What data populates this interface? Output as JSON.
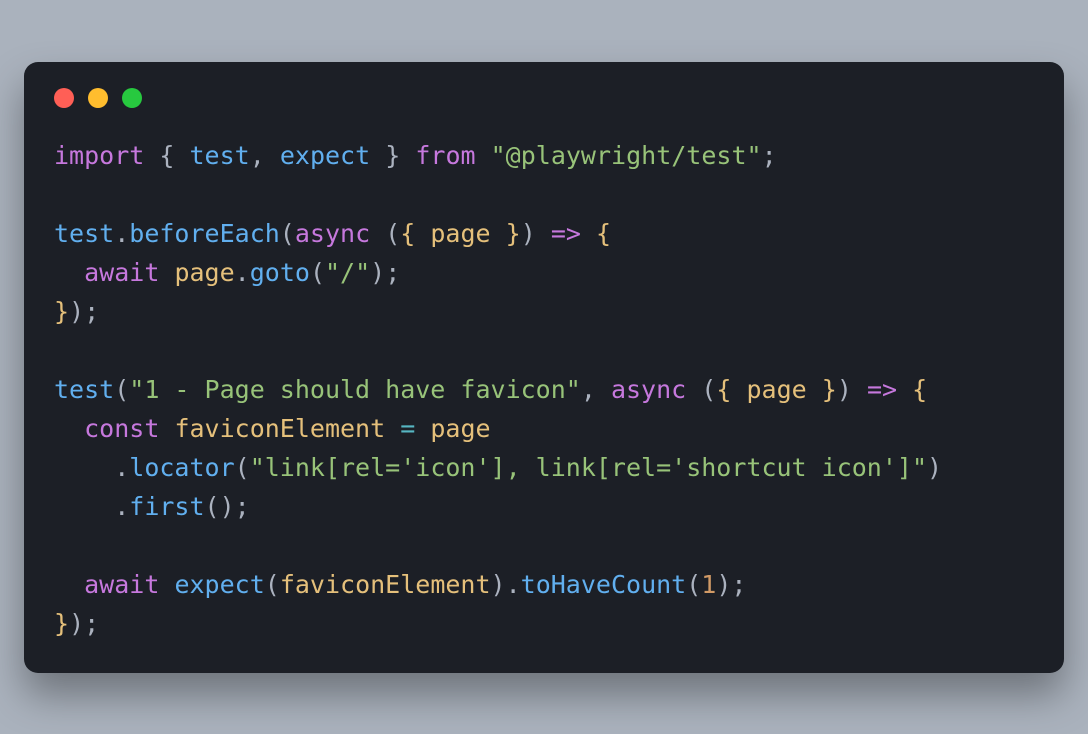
{
  "code": {
    "line1": {
      "kw_import": "import",
      "brace_open": "{",
      "id_test": "test",
      "comma1": ",",
      "id_expect": "expect",
      "brace_close": "}",
      "kw_from": "from",
      "str_module": "\"@playwright/test\"",
      "semi": ";"
    },
    "line3": {
      "fn_test": "test",
      "dot": ".",
      "fn_beforeEach": "beforeEach",
      "paren_open": "(",
      "kw_async": "async",
      "paren2_open": "(",
      "brace_open": "{",
      "id_page": "page",
      "brace_close": "}",
      "paren2_close": ")",
      "arrow": "=>",
      "brace2_open": "{"
    },
    "line4": {
      "kw_await": "await",
      "id_page": "page",
      "dot": ".",
      "fn_goto": "goto",
      "paren_open": "(",
      "str_path": "\"/\"",
      "paren_close": ")",
      "semi": ";"
    },
    "line5": {
      "brace_close": "}",
      "paren_close": ")",
      "semi": ";"
    },
    "line7": {
      "fn_test": "test",
      "paren_open": "(",
      "str_desc": "\"1 - Page should have favicon\"",
      "comma": ",",
      "kw_async": "async",
      "paren2_open": "(",
      "brace_open": "{",
      "id_page": "page",
      "brace_close": "}",
      "paren2_close": ")",
      "arrow": "=>",
      "brace2_open": "{"
    },
    "line8": {
      "kw_const": "const",
      "id_faviconElement": "faviconElement",
      "op_eq": "=",
      "id_page": "page"
    },
    "line9": {
      "dot": ".",
      "fn_locator": "locator",
      "paren_open": "(",
      "str_sel": "\"link[rel='icon'], link[rel='shortcut icon']\"",
      "paren_close": ")"
    },
    "line10": {
      "dot": ".",
      "fn_first": "first",
      "paren_open": "(",
      "paren_close": ")",
      "semi": ";"
    },
    "line12": {
      "kw_await": "await",
      "fn_expect": "expect",
      "paren_open": "(",
      "id_faviconElement": "faviconElement",
      "paren_close": ")",
      "dot": ".",
      "fn_toHaveCount": "toHaveCount",
      "paren2_open": "(",
      "num_1": "1",
      "paren2_close": ")",
      "semi": ";"
    },
    "line13": {
      "brace_close": "}",
      "paren_close": ")",
      "semi": ";"
    }
  }
}
